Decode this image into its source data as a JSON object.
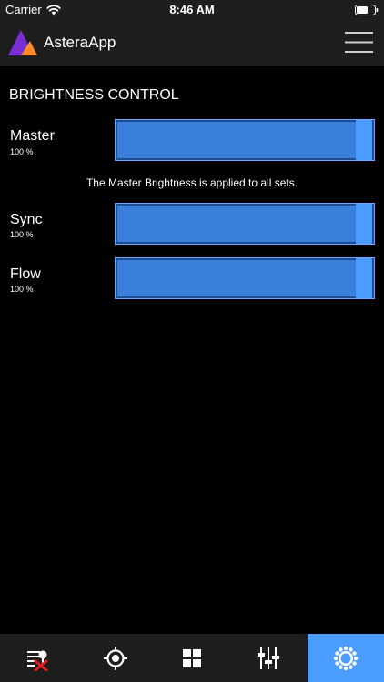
{
  "status_bar": {
    "carrier": "Carrier",
    "time": "8:46 AM"
  },
  "app": {
    "title": "AsteraApp",
    "logo_colors": [
      "#7a2fd6",
      "#ff8a2a"
    ]
  },
  "page": {
    "title": "BRIGHTNESS CONTROL"
  },
  "sliders": [
    {
      "label": "Master",
      "value_text": "100 %",
      "value": 1.0
    },
    {
      "label": "Sync",
      "value_text": "100 %",
      "value": 1.0
    },
    {
      "label": "Flow",
      "value_text": "100 %",
      "value": 1.0
    }
  ],
  "master_note": "The Master Brightness is applied to all sets.",
  "tabs": [
    {
      "icon": "lamp-list-remove-icon",
      "active": false
    },
    {
      "icon": "target-icon",
      "active": false
    },
    {
      "icon": "grid-icon",
      "active": false
    },
    {
      "icon": "mixer-sliders-icon",
      "active": false
    },
    {
      "icon": "brightness-sun-icon",
      "active": true
    }
  ],
  "colors": {
    "accent": "#4a9cff",
    "slider_fill": "#3a7fd9",
    "bar_background": "#1e1e1e",
    "background": "#000000",
    "remove_red": "#e02020"
  }
}
